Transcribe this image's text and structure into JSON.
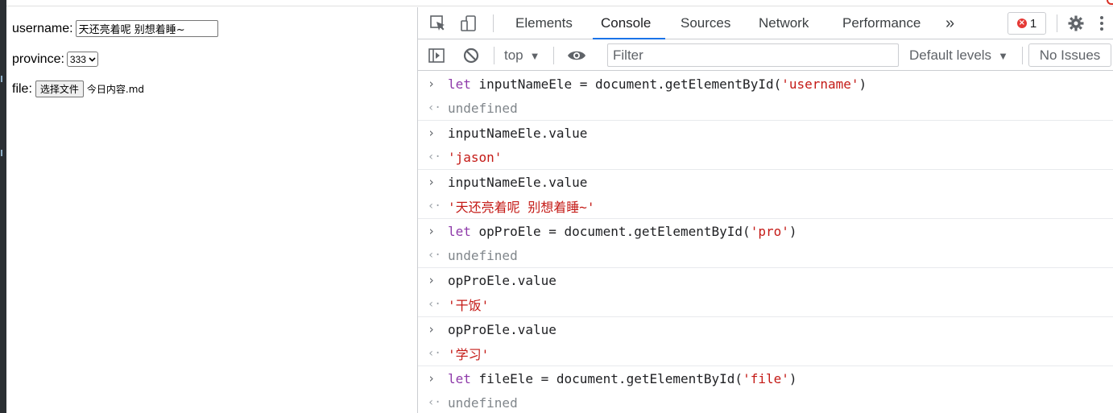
{
  "page": {
    "username_label": "username:",
    "username_value": "天还亮着呢 别想着睡~",
    "province_label": "province:",
    "province_selected": "333",
    "file_label": "file:",
    "file_button": "选择文件",
    "file_name": "今日内容.md"
  },
  "devtools": {
    "tabs": [
      "Elements",
      "Console",
      "Sources",
      "Network",
      "Performance"
    ],
    "active_tab": "Console",
    "more_tabs": "»",
    "error_count": "1",
    "context": "top",
    "filter_placeholder": "Filter",
    "levels": "Default levels",
    "issues": "No Issues"
  },
  "console": [
    {
      "input": [
        [
          "kw",
          "let"
        ],
        [
          "",
          "  inputNameEle = document.getElementById("
        ],
        [
          "str",
          "'username'"
        ],
        [
          "",
          ")"
        ]
      ],
      "result": "undefined",
      "result_type": "undef"
    },
    {
      "input": [
        [
          "",
          "inputNameEle.value"
        ]
      ],
      "result": "'jason'",
      "result_type": "str"
    },
    {
      "input": [
        [
          "",
          "inputNameEle.value"
        ]
      ],
      "result": "'天还亮着呢 别想着睡~'",
      "result_type": "str"
    },
    {
      "input": [
        [
          "kw",
          "let"
        ],
        [
          "",
          "  opProEle = document.getElementById("
        ],
        [
          "str",
          "'pro'"
        ],
        [
          "",
          ")"
        ]
      ],
      "result": "undefined",
      "result_type": "undef"
    },
    {
      "input": [
        [
          "",
          "opProEle.value"
        ]
      ],
      "result": "'干饭'",
      "result_type": "str"
    },
    {
      "input": [
        [
          "",
          "opProEle.value"
        ]
      ],
      "result": "'学习'",
      "result_type": "str"
    },
    {
      "input": [
        [
          "kw",
          "let"
        ],
        [
          "",
          "  fileEle = document.getElementById("
        ],
        [
          "str",
          "'file'"
        ],
        [
          "",
          ")"
        ]
      ],
      "result": "undefined",
      "result_type": "undef"
    }
  ],
  "colors": {
    "accent": "#1a73e8",
    "string": "#c41a16",
    "keyword": "#8e3aa9",
    "error": "#e53935"
  }
}
